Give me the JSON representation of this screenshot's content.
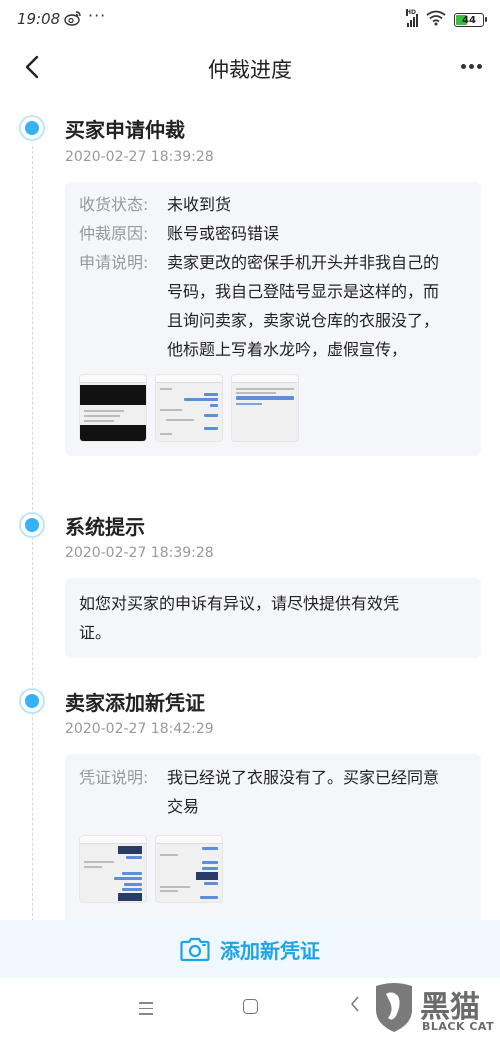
{
  "status_bar": {
    "time": "19:08",
    "app_icon": "weibo-icon",
    "more": "···",
    "network_label": "HD",
    "battery": "44",
    "battery_level_percent": 44
  },
  "nav": {
    "title": "仲裁进度",
    "back_icon": "chevron-left-icon",
    "more_icon": "more-dots-icon"
  },
  "events": [
    {
      "title": "买家申请仲裁",
      "time": "2020-02-27 18:39:28",
      "fields": [
        {
          "label": "收货状态:",
          "value": "未收到货"
        },
        {
          "label": "仲裁原因:",
          "value": "账号或密码错误"
        },
        {
          "label": "申请说明:",
          "value": "卖家更改的密保手机开头并非我自己的号码，我自己登陆号显示是这样的，而且询问卖家，卖家说仓库的衣服没了，他标题上写着水龙吟，虚假宣传，"
        }
      ],
      "image_count": 3
    },
    {
      "title": "系统提示",
      "time": "2020-02-27 18:39:28",
      "text": "如您对买家的申诉有异议，请尽快提供有效凭证。"
    },
    {
      "title": "卖家添加新凭证",
      "time": "2020-02-27 18:42:29",
      "fields": [
        {
          "label": "凭证说明:",
          "value": "我已经说了衣服没有了。买家已经同意交易"
        }
      ],
      "image_count": 2
    }
  ],
  "bottom_action": {
    "label": "添加新凭证",
    "icon": "camera-icon",
    "color": "#1fa3e8"
  },
  "system_nav": {
    "menu_icon": "menu-icon",
    "home_icon": "home-icon",
    "back_icon": "back-icon"
  },
  "watermark": {
    "cn": "黑猫",
    "en": "BLACK CAT"
  },
  "colors": {
    "accent": "#35b1f5",
    "card_bg": "#f5f6f9",
    "label": "#999999",
    "action_bg": "#eff8fe"
  }
}
